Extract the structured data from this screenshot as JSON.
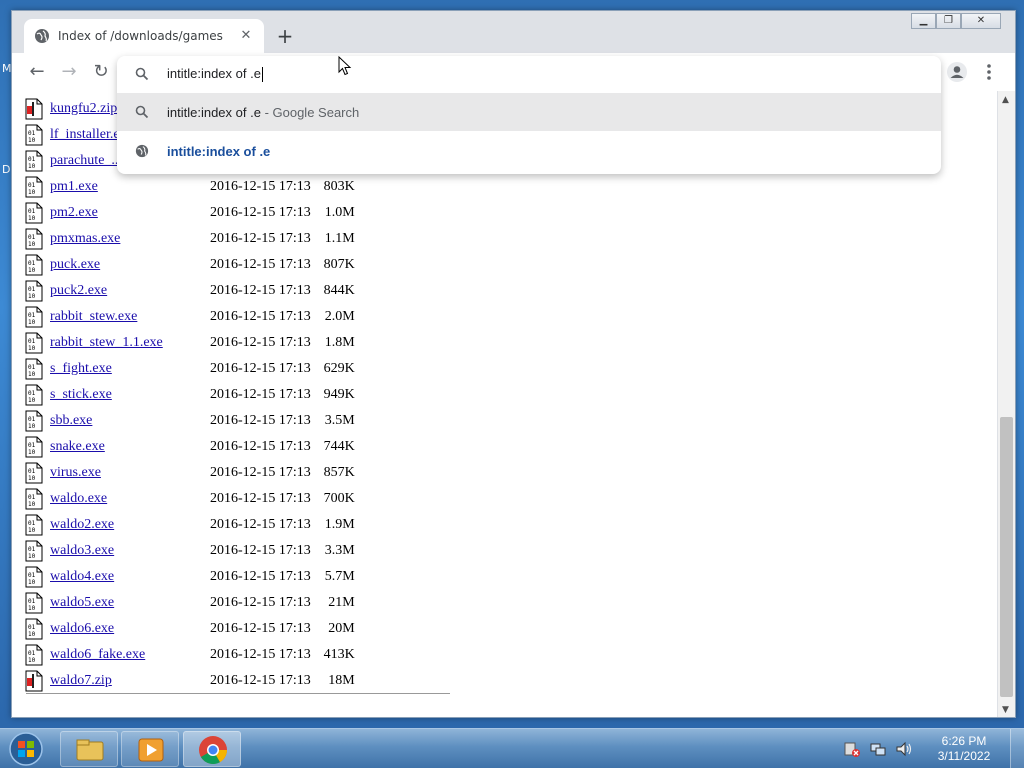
{
  "desktop": {
    "labels": [
      "M",
      "D"
    ]
  },
  "browser": {
    "tab_title": "Index of /downloads/games",
    "tab_close": "✕",
    "new_tab": "+",
    "window_controls": {
      "minimize": "▁",
      "restore": "❐",
      "close": "✕"
    },
    "nav": {
      "back": "←",
      "forward": "→",
      "reload": "↻"
    }
  },
  "omnibox": {
    "input_text": "intitle:index of .e",
    "suggestions": [
      {
        "text": "intitle:index of .e",
        "sub": " - Google Search",
        "icon": "search-icon"
      },
      {
        "text": "intitle:index of .e",
        "icon": "globe-icon"
      }
    ]
  },
  "listing": {
    "rows": [
      {
        "name": "kungfu2.zip",
        "date": "",
        "size": "",
        "icon": "zip-file-icon"
      },
      {
        "name": "lf_installer.exe",
        "date": "",
        "size": "",
        "icon": "binary-file-icon"
      },
      {
        "name": "parachute_...",
        "date": "",
        "size": "",
        "icon": "binary-file-icon"
      },
      {
        "name": "pm1.exe",
        "date": "2016-12-15 17:13",
        "size": "803K",
        "icon": "binary-file-icon"
      },
      {
        "name": "pm2.exe",
        "date": "2016-12-15 17:13",
        "size": "1.0M",
        "icon": "binary-file-icon"
      },
      {
        "name": "pmxmas.exe",
        "date": "2016-12-15 17:13",
        "size": "1.1M",
        "icon": "binary-file-icon"
      },
      {
        "name": "puck.exe",
        "date": "2016-12-15 17:13",
        "size": "807K",
        "icon": "binary-file-icon"
      },
      {
        "name": "puck2.exe",
        "date": "2016-12-15 17:13",
        "size": "844K",
        "icon": "binary-file-icon"
      },
      {
        "name": "rabbit_stew.exe",
        "date": "2016-12-15 17:13",
        "size": "2.0M",
        "icon": "binary-file-icon"
      },
      {
        "name": "rabbit_stew_1.1.exe",
        "date": "2016-12-15 17:13",
        "size": "1.8M",
        "icon": "binary-file-icon"
      },
      {
        "name": "s_fight.exe",
        "date": "2016-12-15 17:13",
        "size": "629K",
        "icon": "binary-file-icon"
      },
      {
        "name": "s_stick.exe",
        "date": "2016-12-15 17:13",
        "size": "949K",
        "icon": "binary-file-icon"
      },
      {
        "name": "sbb.exe",
        "date": "2016-12-15 17:13",
        "size": "3.5M",
        "icon": "binary-file-icon"
      },
      {
        "name": "snake.exe",
        "date": "2016-12-15 17:13",
        "size": "744K",
        "icon": "binary-file-icon"
      },
      {
        "name": "virus.exe",
        "date": "2016-12-15 17:13",
        "size": "857K",
        "icon": "binary-file-icon"
      },
      {
        "name": "waldo.exe",
        "date": "2016-12-15 17:13",
        "size": "700K",
        "icon": "binary-file-icon"
      },
      {
        "name": "waldo2.exe",
        "date": "2016-12-15 17:13",
        "size": "1.9M",
        "icon": "binary-file-icon"
      },
      {
        "name": "waldo3.exe",
        "date": "2016-12-15 17:13",
        "size": "3.3M",
        "icon": "binary-file-icon"
      },
      {
        "name": "waldo4.exe",
        "date": "2016-12-15 17:13",
        "size": "5.7M",
        "icon": "binary-file-icon"
      },
      {
        "name": "waldo5.exe",
        "date": "2016-12-15 17:13",
        "size": "21M",
        "icon": "binary-file-icon"
      },
      {
        "name": "waldo6.exe",
        "date": "2016-12-15 17:13",
        "size": "20M",
        "icon": "binary-file-icon"
      },
      {
        "name": "waldo6_fake.exe",
        "date": "2016-12-15 17:13",
        "size": "413K",
        "icon": "binary-file-icon"
      },
      {
        "name": "waldo7.zip",
        "date": "2016-12-15 17:13",
        "size": "18M",
        "icon": "zip-file-icon"
      }
    ]
  },
  "taskbar": {
    "time": "6:26 PM",
    "date": "3/11/2022",
    "apps": [
      "explorer-icon",
      "media-player-icon",
      "chrome-icon"
    ]
  }
}
